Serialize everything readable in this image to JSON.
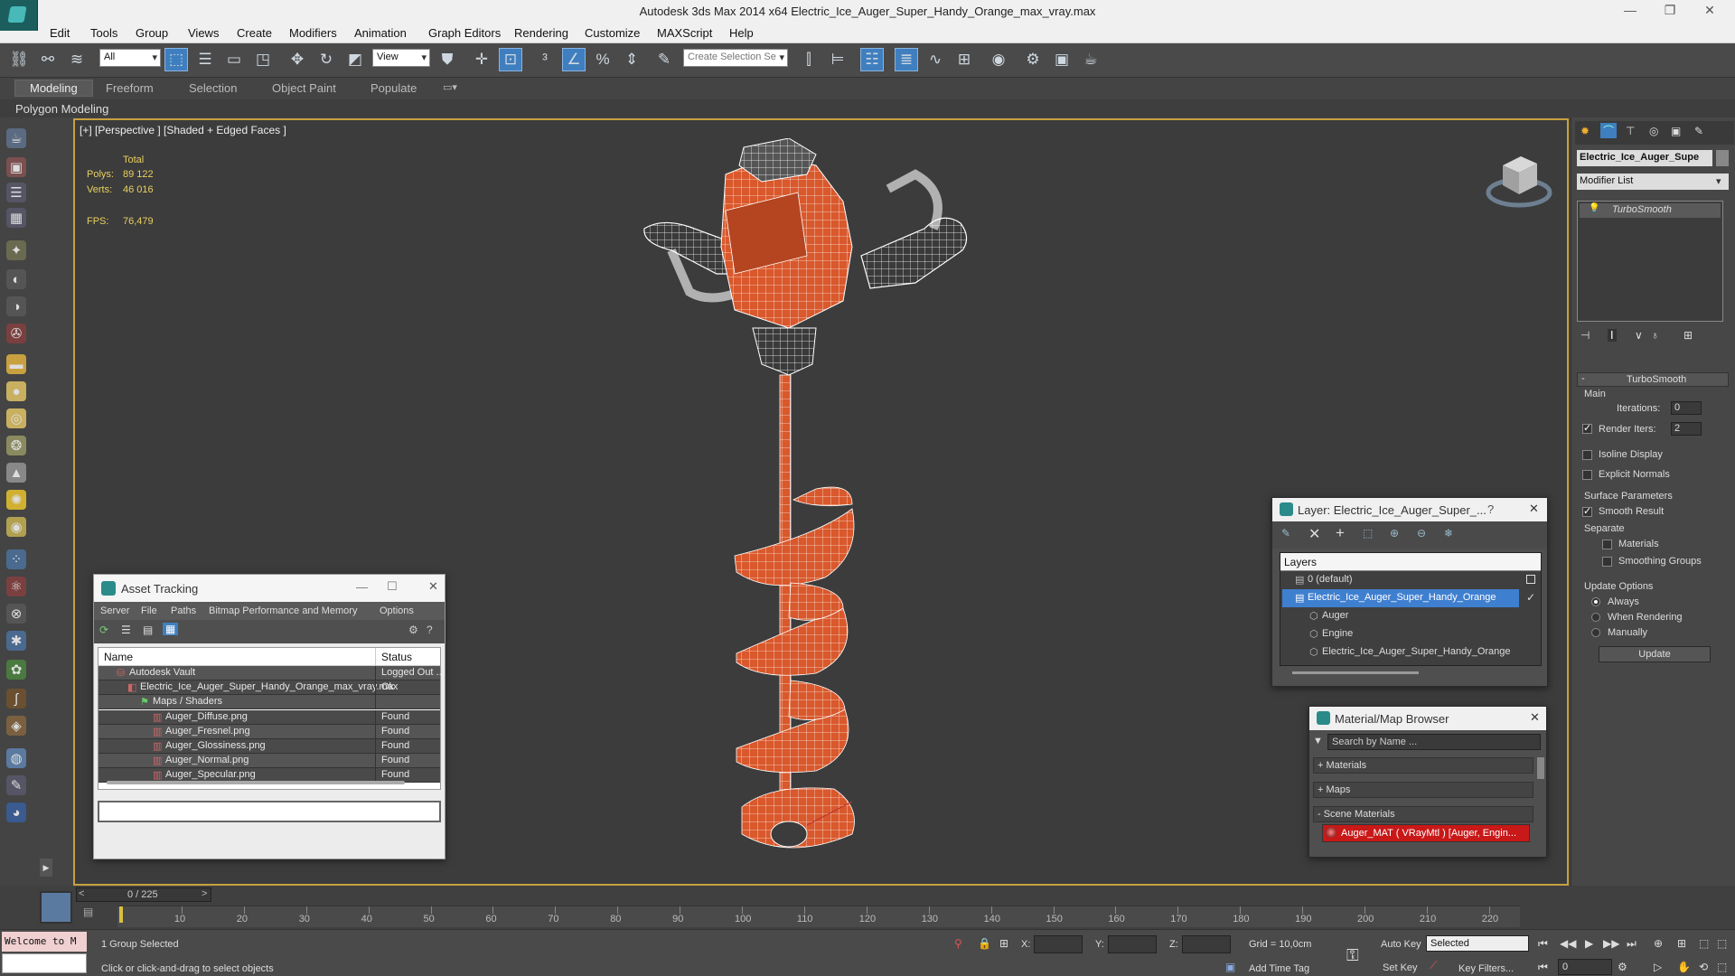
{
  "window": {
    "title": "Autodesk 3ds Max  2014 x64    Electric_Ice_Auger_Super_Handy_Orange_max_vray.max",
    "minimize": "—",
    "maximize": "❐",
    "close": "✕"
  },
  "menubar": [
    "Edit",
    "Tools",
    "Group",
    "Views",
    "Create",
    "Modifiers",
    "Animation",
    "Graph Editors",
    "Rendering",
    "Customize",
    "MAXScript",
    "Help"
  ],
  "toolbar": {
    "filter_value": "All",
    "refcoord_value": "View",
    "selection_set_placeholder": "Create Selection Se"
  },
  "ribbon": {
    "tabs": [
      "Modeling",
      "Freeform",
      "Selection",
      "Object Paint",
      "Populate"
    ],
    "sub": "Polygon Modeling"
  },
  "viewport": {
    "label": "[+] [Perspective ] [Shaded + Edged Faces ]",
    "stats_header": "Total",
    "polys_label": "Polys:",
    "polys_value": "89 122",
    "verts_label": "Verts:",
    "verts_value": "46 016",
    "fps_label": "FPS:",
    "fps_value": "76,479",
    "wire_color": "#ffffff",
    "model_color": "#d9582c"
  },
  "asset_tracking": {
    "title": "Asset Tracking",
    "menu": [
      "Server",
      "File",
      "Paths",
      "Bitmap Performance and Memory",
      "Options"
    ],
    "col_name": "Name",
    "col_status": "Status",
    "rows": [
      {
        "name": "Autodesk Vault",
        "status": "Logged Out ..."
      },
      {
        "name": "Electric_Ice_Auger_Super_Handy_Orange_max_vray.max",
        "status": "Ok"
      },
      {
        "name": "Maps / Shaders",
        "status": ""
      },
      {
        "name": "Auger_Diffuse.png",
        "status": "Found"
      },
      {
        "name": "Auger_Fresnel.png",
        "status": "Found"
      },
      {
        "name": "Auger_Glossiness.png",
        "status": "Found"
      },
      {
        "name": "Auger_Normal.png",
        "status": "Found"
      },
      {
        "name": "Auger_Specular.png",
        "status": "Found"
      }
    ]
  },
  "layer_window": {
    "title": "Layer: Electric_Ice_Auger_Super_...",
    "help": "?",
    "header": "Layers",
    "rows": [
      "0 (default)",
      "Electric_Ice_Auger_Super_Handy_Orange",
      "Auger",
      "Engine",
      "Electric_Ice_Auger_Super_Handy_Orange"
    ]
  },
  "material_browser": {
    "title": "Material/Map Browser",
    "search_placeholder": "Search by Name ...",
    "groups": [
      "+ Materials",
      "+ Maps",
      "- Scene Materials"
    ],
    "material": "Auger_MAT  ( VRayMtl )  [Auger, Engin..."
  },
  "command_panel": {
    "object_name": "Electric_Ice_Auger_Supe",
    "modifier_list": "Modifier List",
    "stack_item": "TurboSmooth",
    "rollout_title": "TurboSmooth",
    "main_label": "Main",
    "iterations_label": "Iterations:",
    "iterations_value": "0",
    "render_iters_label": "Render Iters:",
    "render_iters_value": "2",
    "isoline": "Isoline Display",
    "explicit": "Explicit Normals",
    "surface_params": "Surface Parameters",
    "smooth_result": "Smooth Result",
    "separate": "Separate",
    "materials": "Materials",
    "smoothing_groups": "Smoothing Groups",
    "update_options": "Update Options",
    "always": "Always",
    "when_rendering": "When Rendering",
    "manually": "Manually",
    "update_btn": "Update"
  },
  "timeline": {
    "frame_counter": "0 / 225",
    "ticks": [
      "10",
      "20",
      "30",
      "40",
      "50",
      "60",
      "70",
      "80",
      "90",
      "100",
      "110",
      "120",
      "130",
      "140",
      "150",
      "160",
      "170",
      "180",
      "190",
      "200",
      "210",
      "220"
    ]
  },
  "status": {
    "maxscript": "Welcome to M",
    "selected": "1 Group Selected",
    "prompt": "Click or click-and-drag to select objects",
    "x_label": "X:",
    "y_label": "Y:",
    "z_label": "Z:",
    "grid": "Grid = 10,0cm",
    "add_time_tag": "Add Time Tag",
    "auto_key": "Auto Key",
    "selected_dropdown": "Selected",
    "set_key": "Set Key",
    "key_filters": "Key Filters...",
    "frame_field": "0"
  }
}
